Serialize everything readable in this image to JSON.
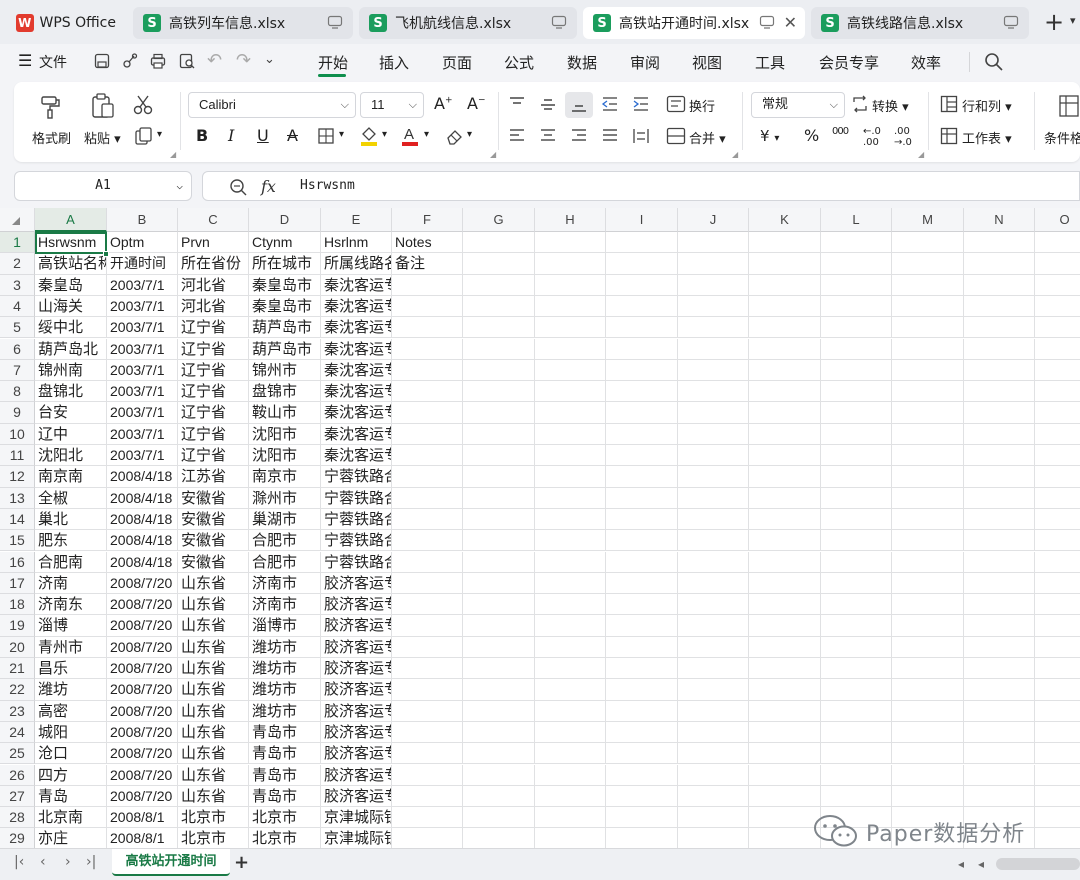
{
  "app": {
    "name": "WPS Office",
    "tabs": [
      {
        "label": "高铁列车信息.xlsx",
        "active": false
      },
      {
        "label": "飞机航线信息.xlsx",
        "active": false
      },
      {
        "label": "高铁站开通时间.xlsx",
        "active": true
      },
      {
        "label": "高铁线路信息.xlsx",
        "active": false
      }
    ],
    "new_tab": "+"
  },
  "menubar": {
    "file": "文件",
    "items": [
      "开始",
      "插入",
      "页面",
      "公式",
      "数据",
      "审阅",
      "视图",
      "工具",
      "会员专享",
      "效率"
    ],
    "active": "开始"
  },
  "ribbon": {
    "format_painter": "格式刷",
    "paste": "粘贴",
    "font_name": "Calibri",
    "font_size": "11",
    "bold": "B",
    "italic": "I",
    "underline": "U",
    "strike": "A",
    "wrap": "换行",
    "merge": "合并",
    "number_format": "常规",
    "convert": "转换",
    "currency": "¥",
    "percent": "%",
    "thousands": "000",
    "rows_cols": "行和列",
    "worksheet": "工作表",
    "conditional": "条件格"
  },
  "formula_bar": {
    "cell_ref": "A1",
    "fx": "fx",
    "value": "Hsrwsnm"
  },
  "grid": {
    "columns": [
      "A",
      "B",
      "C",
      "D",
      "E",
      "F",
      "G",
      "H",
      "I",
      "J",
      "K",
      "L",
      "M",
      "N",
      "O"
    ],
    "selected_cell": "A1",
    "rows": [
      {
        "num": "1",
        "cells": [
          "Hsrwsnm",
          "Optm",
          "Prvn",
          "Ctynm",
          "Hsrlnm",
          "Notes"
        ]
      },
      {
        "num": "2",
        "cells": [
          "高铁站名称",
          "开通时间",
          "所在省份",
          "所在城市",
          "所属线路名称",
          "备注"
        ]
      },
      {
        "num": "3",
        "cells": [
          "秦皇岛",
          "2003/7/1",
          "河北省",
          "秦皇岛市",
          "秦沈客运专线",
          ""
        ]
      },
      {
        "num": "4",
        "cells": [
          "山海关",
          "2003/7/1",
          "河北省",
          "秦皇岛市",
          "秦沈客运专线",
          ""
        ]
      },
      {
        "num": "5",
        "cells": [
          "绥中北",
          "2003/7/1",
          "辽宁省",
          "葫芦岛市",
          "秦沈客运专线",
          ""
        ]
      },
      {
        "num": "6",
        "cells": [
          "葫芦岛北",
          "2003/7/1",
          "辽宁省",
          "葫芦岛市",
          "秦沈客运专线",
          ""
        ]
      },
      {
        "num": "7",
        "cells": [
          "锦州南",
          "2003/7/1",
          "辽宁省",
          "锦州市",
          "秦沈客运专线",
          ""
        ]
      },
      {
        "num": "8",
        "cells": [
          "盘锦北",
          "2003/7/1",
          "辽宁省",
          "盘锦市",
          "秦沈客运专线",
          ""
        ]
      },
      {
        "num": "9",
        "cells": [
          "台安",
          "2003/7/1",
          "辽宁省",
          "鞍山市",
          "秦沈客运专线",
          ""
        ]
      },
      {
        "num": "10",
        "cells": [
          "辽中",
          "2003/7/1",
          "辽宁省",
          "沈阳市",
          "秦沈客运专线",
          ""
        ]
      },
      {
        "num": "11",
        "cells": [
          "沈阳北",
          "2003/7/1",
          "辽宁省",
          "沈阳市",
          "秦沈客运专线",
          ""
        ]
      },
      {
        "num": "12",
        "cells": [
          "南京南",
          "2008/4/18",
          "江苏省",
          "南京市",
          "宁蓉铁路合宁段",
          ""
        ]
      },
      {
        "num": "13",
        "cells": [
          "全椒",
          "2008/4/18",
          "安徽省",
          "滁州市",
          "宁蓉铁路合宁段",
          ""
        ]
      },
      {
        "num": "14",
        "cells": [
          "巢北",
          "2008/4/18",
          "安徽省",
          "巢湖市",
          "宁蓉铁路合宁段",
          ""
        ]
      },
      {
        "num": "15",
        "cells": [
          "肥东",
          "2008/4/18",
          "安徽省",
          "合肥市",
          "宁蓉铁路合宁段",
          ""
        ]
      },
      {
        "num": "16",
        "cells": [
          "合肥南",
          "2008/4/18",
          "安徽省",
          "合肥市",
          "宁蓉铁路合宁段",
          ""
        ]
      },
      {
        "num": "17",
        "cells": [
          "济南",
          "2008/7/20",
          "山东省",
          "济南市",
          "胶济客运专线",
          ""
        ]
      },
      {
        "num": "18",
        "cells": [
          "济南东",
          "2008/7/20",
          "山东省",
          "济南市",
          "胶济客运专线",
          ""
        ]
      },
      {
        "num": "19",
        "cells": [
          "淄博",
          "2008/7/20",
          "山东省",
          "淄博市",
          "胶济客运专线",
          ""
        ]
      },
      {
        "num": "20",
        "cells": [
          "青州市",
          "2008/7/20",
          "山东省",
          "潍坊市",
          "胶济客运专线",
          ""
        ]
      },
      {
        "num": "21",
        "cells": [
          "昌乐",
          "2008/7/20",
          "山东省",
          "潍坊市",
          "胶济客运专线",
          ""
        ]
      },
      {
        "num": "22",
        "cells": [
          "潍坊",
          "2008/7/20",
          "山东省",
          "潍坊市",
          "胶济客运专线",
          ""
        ]
      },
      {
        "num": "23",
        "cells": [
          "高密",
          "2008/7/20",
          "山东省",
          "潍坊市",
          "胶济客运专线",
          ""
        ]
      },
      {
        "num": "24",
        "cells": [
          "城阳",
          "2008/7/20",
          "山东省",
          "青岛市",
          "胶济客运专线",
          ""
        ]
      },
      {
        "num": "25",
        "cells": [
          "沧口",
          "2008/7/20",
          "山东省",
          "青岛市",
          "胶济客运专线",
          ""
        ]
      },
      {
        "num": "26",
        "cells": [
          "四方",
          "2008/7/20",
          "山东省",
          "青岛市",
          "胶济客运专线",
          ""
        ]
      },
      {
        "num": "27",
        "cells": [
          "青岛",
          "2008/7/20",
          "山东省",
          "青岛市",
          "胶济客运专线",
          ""
        ]
      },
      {
        "num": "28",
        "cells": [
          "北京南",
          "2008/8/1",
          "北京市",
          "北京市",
          "京津城际铁路",
          ""
        ]
      },
      {
        "num": "29",
        "cells": [
          "亦庄",
          "2008/8/1",
          "北京市",
          "北京市",
          "京津城际铁路",
          ""
        ]
      }
    ]
  },
  "sheets": {
    "tabs": [
      "高铁站开通时间"
    ],
    "add": "+"
  },
  "watermark": {
    "text": "Paper数据分析"
  },
  "colors": {
    "accent": "#1a7a46",
    "wps_red": "#e23b2e",
    "sheet_badge": "#1b9d5d"
  }
}
